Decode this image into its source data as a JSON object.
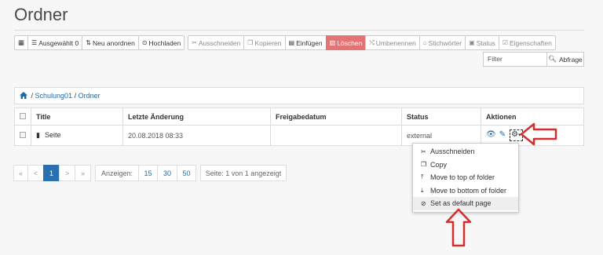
{
  "page": {
    "title": "Ordner"
  },
  "toolbar": {
    "grid_icon": "▦",
    "selected": "Ausgewählt 0",
    "rearrange": "Neu anordnen",
    "upload": "Hochladen",
    "cut": "Ausschneiden",
    "copy": "Kopieren",
    "paste": "Einfügen",
    "delete": "Löschen",
    "rename": "Umbenennen",
    "keywords": "Stichwörter",
    "status": "Status",
    "properties": "Eigenschaften"
  },
  "search": {
    "placeholder": "Filter",
    "button": "Abfrage"
  },
  "breadcrumb": {
    "sep": " / ",
    "level1": "Schulung01",
    "level2": "Ordner"
  },
  "table": {
    "headers": [
      "Title",
      "Letzte Änderung",
      "Freigabedatum",
      "Status",
      "Aktionen"
    ],
    "rows": [
      {
        "title": "Seite",
        "modified": "20.08.2018 08:33",
        "release": "",
        "status": "external"
      }
    ]
  },
  "action_menu": {
    "items": [
      {
        "label": "Ausschneiden",
        "icon": "scissors-icon"
      },
      {
        "label": "Copy",
        "icon": "copy-icon"
      },
      {
        "label": "Move to top of folder",
        "icon": "move-top-icon"
      },
      {
        "label": "Move to bottom of folder",
        "icon": "move-bottom-icon"
      },
      {
        "label": "Set as default page",
        "icon": "check-circle-icon"
      }
    ]
  },
  "pagination": {
    "first": "«",
    "prev": "<",
    "current": "1",
    "next": ">",
    "last": "»",
    "show_label": "Anzeigen:",
    "sizes": [
      "15",
      "30",
      "50"
    ],
    "info": "Seite: 1 von 1 angezeigt"
  },
  "colors": {
    "accent": "#2a6fb0",
    "link": "#1f6aa5",
    "danger": "#e57373",
    "annotation_arrow": "#d32f2f"
  }
}
